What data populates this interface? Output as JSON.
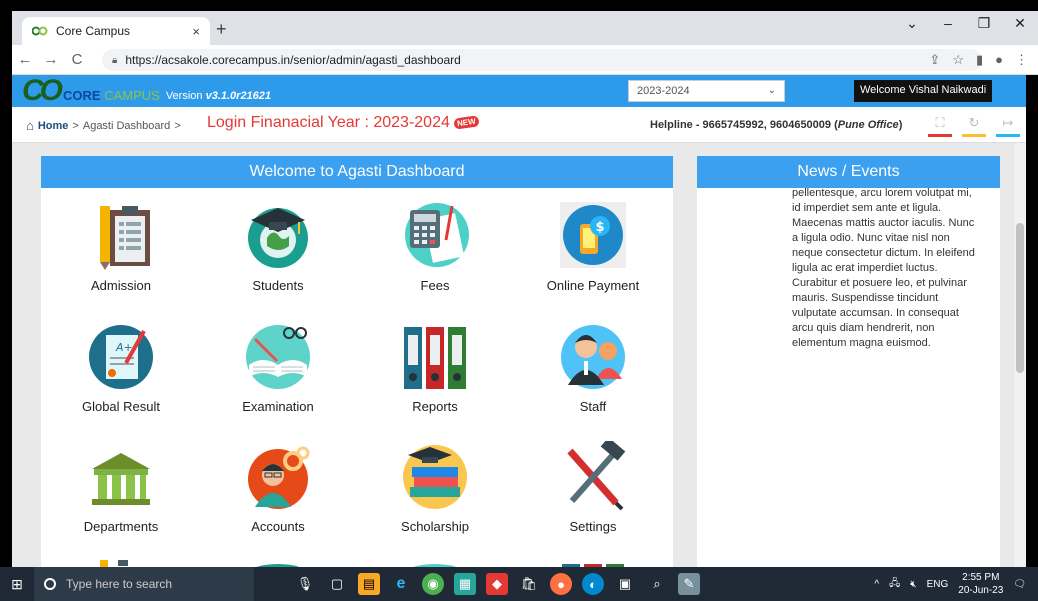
{
  "browser": {
    "tab_title": "Core Campus",
    "tab_close": "×",
    "new_tab": "+",
    "url": "https://acsakole.corecampus.in/senior/admin/agasti_dashboard",
    "minimize": "–",
    "maximize": "❐",
    "close": "✕",
    "back": "←",
    "forward": "→",
    "reload": "C"
  },
  "header": {
    "logo_letters": "CO",
    "brand_core": "CORE",
    "brand_campus": "CAMPUS",
    "version_prefix": "Version",
    "version": "v3.1.0r21621",
    "year_selected": "2023-2024",
    "welcome": "Welcome Vishal Naikwadi"
  },
  "breadcrumb": {
    "home": "Home",
    "sep1": ">",
    "current": "Agasti Dashboard",
    "sep2": ">",
    "login_year": "Login Finanacial Year : 2023-2024",
    "new_badge": "NEW",
    "helpline": "Helpline - 9665745992, 9604650009 (",
    "helpline_office": "Pune Office",
    "helpline_end": ")"
  },
  "dashboard": {
    "title": "Welcome to Agasti Dashboard",
    "tiles": [
      {
        "label": "Admission"
      },
      {
        "label": "Students"
      },
      {
        "label": "Fees"
      },
      {
        "label": "Online Payment"
      },
      {
        "label": "Global Result"
      },
      {
        "label": "Examination"
      },
      {
        "label": "Reports"
      },
      {
        "label": "Staff"
      },
      {
        "label": "Departments"
      },
      {
        "label": "Accounts"
      },
      {
        "label": "Scholarship"
      },
      {
        "label": "Settings"
      }
    ]
  },
  "news": {
    "title": "News / Events",
    "body": "pellentesque, arcu lorem volutpat mi, id imperdiet sem ante et ligula. Maecenas mattis auctor iaculis. Nunc a ligula odio. Nunc vitae nisl non neque consectetur dictum. In eleifend ligula ac erat imperdiet luctus. Curabitur et posuere leo, et pulvinar mauris. Suspendisse tincidunt vulputate accumsan. In consequat arcu quis diam hendrerit, non elementum magna euismod."
  },
  "taskbar": {
    "search_placeholder": "Type here to search",
    "lang": "ENG",
    "time": "2:55 PM",
    "date": "20-Jun-23"
  }
}
